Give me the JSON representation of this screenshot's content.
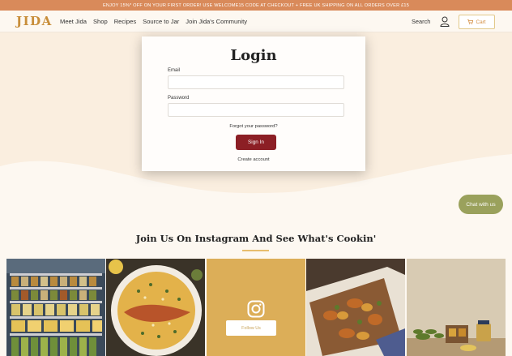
{
  "promo": {
    "text": "ENJOY 15%* OFF ON YOUR FIRST ORDER! USE WELCOME15 CODE AT CHECKOUT + FREE UK SHIPPING ON ALL ORDERS OVER £15"
  },
  "header": {
    "logo": "JIDA",
    "nav": [
      "Meet Jida",
      "Shop",
      "Recipes",
      "Source to Jar",
      "Join Jida's Community"
    ],
    "search_label": "Search",
    "cart_label": "Cart"
  },
  "login": {
    "title": "Login",
    "email_label": "Email",
    "email_value": "",
    "password_label": "Password",
    "password_value": "",
    "forgot_link": "Forgot your password?",
    "signin_button": "Sign In",
    "create_account": "Create account"
  },
  "chat": {
    "label": "Chat with us"
  },
  "instagram": {
    "title": "Join Us On Instagram And See What's Cookin'",
    "follow_button": "Follow Us"
  },
  "colors": {
    "accent": "#8c1f25",
    "brand": "#c88e3a",
    "promo": "#d98a5a",
    "chat": "#9aa15c",
    "insta_tile": "#dcae58"
  }
}
